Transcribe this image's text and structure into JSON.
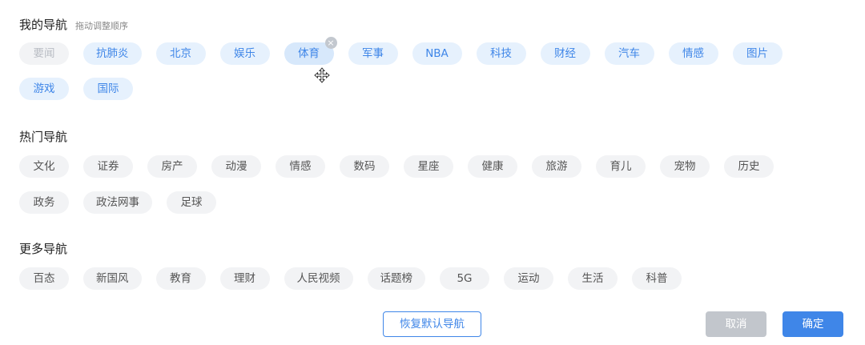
{
  "my_nav": {
    "title": "我的导航",
    "hint": "拖动调整顺序",
    "fixed_item": "要闻",
    "row1": [
      "抗肺炎",
      "北京",
      "娱乐",
      "体育",
      "军事",
      "NBA",
      "科技",
      "财经",
      "汽车",
      "情感",
      "图片"
    ],
    "row2": [
      "游戏",
      "国际"
    ],
    "remove_glyph": "×"
  },
  "hot_nav": {
    "title": "热门导航",
    "row1": [
      "文化",
      "证券",
      "房产",
      "动漫",
      "情感",
      "数码",
      "星座",
      "健康",
      "旅游",
      "育儿",
      "宠物",
      "历史"
    ],
    "row2": [
      "政务",
      "政法网事",
      "足球"
    ]
  },
  "more_nav": {
    "title": "更多导航",
    "row1": [
      "百态",
      "新国风",
      "教育",
      "理财",
      "人民视频",
      "话题榜",
      "5G",
      "运动",
      "生活",
      "科普"
    ]
  },
  "buttons": {
    "restore": "恢复默认导航",
    "cancel": "取消",
    "confirm": "确定"
  },
  "colors": {
    "accent": "#3f86e8",
    "chip_selected_bg": "#e6f1fd",
    "chip_default_bg": "#f2f3f5",
    "cancel_bg": "#c2c6cc"
  },
  "icons": {
    "remove": "close-circle-icon",
    "drag_cursor": "move-cursor-icon"
  }
}
